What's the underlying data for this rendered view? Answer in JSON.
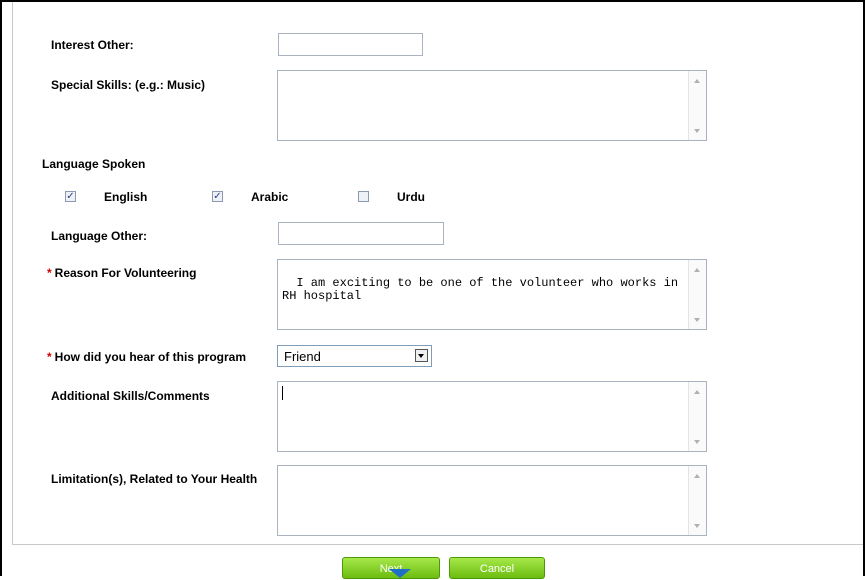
{
  "form": {
    "interest_other": {
      "label": "Interest Other:",
      "value": ""
    },
    "special_skills": {
      "label": "Special Skills: (e.g.: Music)",
      "value": ""
    },
    "language_spoken": {
      "label": "Language Spoken",
      "options": [
        {
          "label": "English",
          "checked": true
        },
        {
          "label": "Arabic",
          "checked": true
        },
        {
          "label": "Urdu",
          "checked": false
        }
      ]
    },
    "language_other": {
      "label": "Language Other:",
      "value": ""
    },
    "reason": {
      "required_mark": "*",
      "label": "Reason For Volunteering",
      "value": "I am exciting to be one of the volunteer who works in RH hospital"
    },
    "how_heard": {
      "required_mark": "*",
      "label": "How did you hear of this program",
      "selected": "Friend"
    },
    "additional_skills": {
      "label": "Additional Skills/Comments",
      "value": ""
    },
    "limitations": {
      "label": "Limitation(s), Related to Your Health",
      "value": ""
    }
  },
  "buttons": {
    "next": "Next",
    "cancel": "Cancel"
  },
  "colors": {
    "required": "#d40000",
    "button_green": "#7cc91a",
    "arrow_blue": "#1f6fc8"
  },
  "icons": {
    "checked": "✓",
    "select_arrow": "chevron-down-icon"
  }
}
